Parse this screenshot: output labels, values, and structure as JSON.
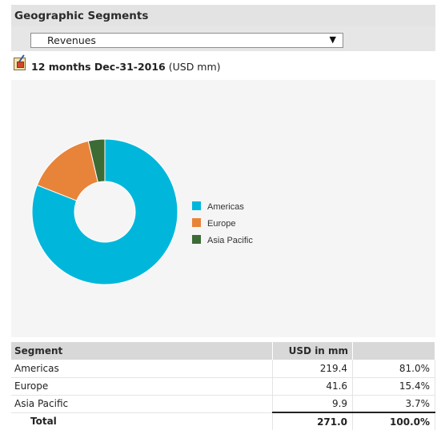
{
  "panel": {
    "title": "Geographic Segments",
    "dropdown": {
      "selected": "Revenues"
    },
    "period": {
      "label_bold": "12 months Dec-31-2016",
      "label_suffix": "(USD mm)"
    }
  },
  "chart_data": {
    "type": "pie",
    "donut": true,
    "categories": [
      "Americas",
      "Europe",
      "Asia Pacific"
    ],
    "values": [
      219.4,
      41.6,
      9.9
    ],
    "colors": [
      "#00b7db",
      "#e8833a",
      "#3d6b35"
    ],
    "legend_position": "right"
  },
  "table": {
    "headers": [
      "Segment",
      "USD in mm",
      ""
    ],
    "rows": [
      {
        "segment": "Americas",
        "value": "219.4",
        "pct": "81.0%"
      },
      {
        "segment": "Europe",
        "value": "41.6",
        "pct": "15.4%"
      },
      {
        "segment": "Asia Pacific",
        "value": "9.9",
        "pct": "3.7%"
      }
    ],
    "total": {
      "label": "Total",
      "value": "271.0",
      "pct": "100.0%"
    }
  }
}
